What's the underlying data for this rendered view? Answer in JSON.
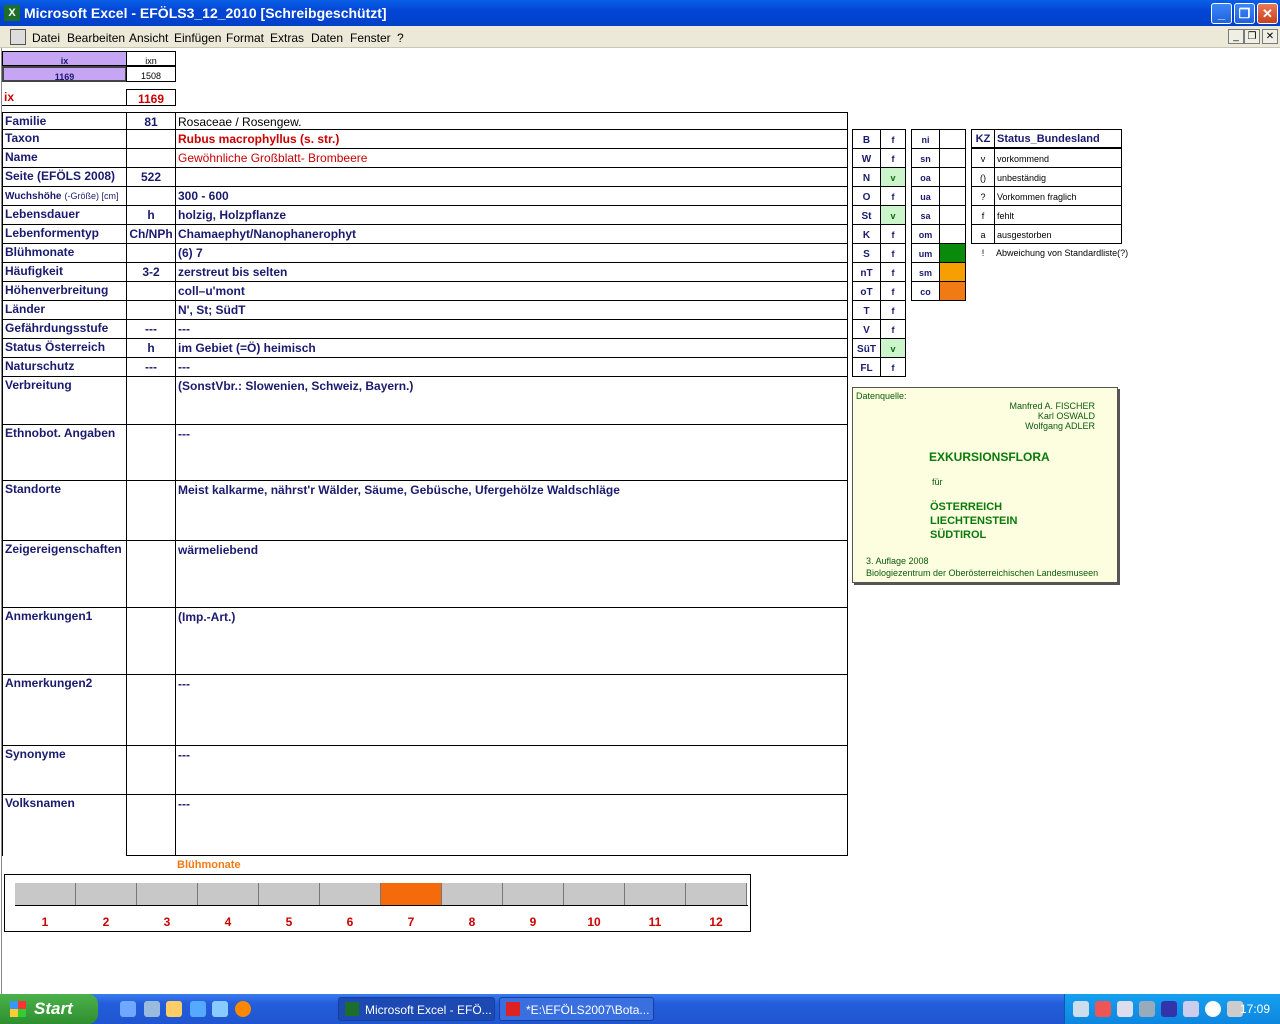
{
  "window": {
    "title": "Microsoft Excel - EFÖLS3_12_2010  [Schreibgeschützt]"
  },
  "menu": [
    "Datei",
    "Bearbeiten",
    "Ansicht",
    "Einfügen",
    "Format",
    "Extras",
    "Daten",
    "Fenster",
    "?"
  ],
  "top": {
    "ix_label": "ix",
    "ixn_label": "ixn",
    "ix_value": "1169",
    "ixn_value": "1508",
    "ix_main_label": "ix",
    "ix_main_value": "1169"
  },
  "rows": [
    {
      "label": "Familie",
      "num": "81",
      "value": "Rosaceae  /  Rosengew."
    },
    {
      "label": "Taxon",
      "num": "",
      "value": "Rubus macrophyllus (s. str.)"
    },
    {
      "label": "Name",
      "num": "",
      "value": "Gewöhnliche Großblatt- Brombeere"
    },
    {
      "label": "Seite (EFÖLS 2008)",
      "num": "522",
      "value": ""
    },
    {
      "label": "Wuchshöhe",
      "label_small": "(-Größe) [cm]",
      "num": "",
      "value": " 300 - 600"
    },
    {
      "label": "Lebensdauer",
      "num": "h",
      "value": "holzig, Holzpflanze"
    },
    {
      "label": "Lebenformentyp",
      "num": "Ch/NPh",
      "value": "Chamaephyt/Nanophanerophyt"
    },
    {
      "label": "Blühmonate",
      "num": "",
      "value": "(6) 7"
    },
    {
      "label": "Häufigkeit",
      "num": "3-2",
      "value": "zerstreut bis selten"
    },
    {
      "label": "Höhenverbreitung",
      "num": "",
      "value": "coll–u'mont"
    },
    {
      "label": "Länder",
      "num": "",
      "value": "N', St; SüdT"
    },
    {
      "label": "Gefährdungsstufe",
      "num": "---",
      "value": "  ---"
    },
    {
      "label": "Status Österreich",
      "num": "h",
      "value": "im Gebiet (=Ö) heimisch"
    },
    {
      "label": "Naturschutz",
      "num": "---",
      "value": " ---"
    },
    {
      "label": "Verbreitung",
      "num": "",
      "value": "(SonstVbr.: Slowenien, Schweiz, Bayern.)"
    },
    {
      "label": "Ethnobot. Angaben",
      "num": "",
      "value": "---"
    },
    {
      "label": "Standorte",
      "num": "",
      "value": "Meist kalkarme, nährst'r Wälder, Säume, Gebüsche, Ufergehölze Waldschläge"
    },
    {
      "label": "Zeigereigenschaften",
      "num": "",
      "value": "wärmeliebend"
    },
    {
      "label": "Anmerkungen1",
      "num": "",
      "value": "(Imp.-Art.)"
    },
    {
      "label": "Anmerkungen2",
      "num": "",
      "value": "---"
    },
    {
      "label": "Synonyme",
      "num": "",
      "value": "---"
    },
    {
      "label": "Volksnamen",
      "num": "",
      "value": "---"
    }
  ],
  "bundesland": [
    {
      "code": "B",
      "status": "f"
    },
    {
      "code": "W",
      "status": "f"
    },
    {
      "code": "N",
      "status": "v"
    },
    {
      "code": "O",
      "status": "f"
    },
    {
      "code": "St",
      "status": "v"
    },
    {
      "code": "K",
      "status": "f"
    },
    {
      "code": "S",
      "status": "f"
    },
    {
      "code": "nT",
      "status": "f"
    },
    {
      "code": "oT",
      "status": "f"
    },
    {
      "code": "T",
      "status": "f"
    },
    {
      "code": "V",
      "status": "f"
    },
    {
      "code": "SüT",
      "status": "v"
    },
    {
      "code": "FL",
      "status": "f"
    }
  ],
  "hoehen": [
    {
      "code": "ni"
    },
    {
      "code": "sn"
    },
    {
      "code": "oa"
    },
    {
      "code": "ua"
    },
    {
      "code": "sa"
    },
    {
      "code": "om"
    },
    {
      "code": "um",
      "color": "#0a8a0a"
    },
    {
      "code": "sm",
      "color": "#f5a000"
    },
    {
      "code": "co",
      "color": "#f07a14"
    }
  ],
  "legend": {
    "kz_header": "KZ",
    "status_header": "Status_Bundesland",
    "items": [
      {
        "kz": "v",
        "text": "vorkommend"
      },
      {
        "kz": "()",
        "text": "unbeständig"
      },
      {
        "kz": "?",
        "text": "Vorkommen fraglich"
      },
      {
        "kz": "f",
        "text": "fehlt"
      },
      {
        "kz": "a",
        "text": "ausgestorben"
      },
      {
        "kz": "!",
        "text": "Abweichung von Standardliste(?)"
      }
    ]
  },
  "source": {
    "label": "Datenquelle:",
    "authors": [
      "Manfred A. FISCHER",
      "Karl OSWALD",
      "Wolfgang ADLER"
    ],
    "title": "EXKURSIONSFLORA",
    "fuer": "für",
    "countries": [
      "ÖSTERREICH",
      "LIECHTENSTEIN",
      "SÜDTIROL"
    ],
    "edition": "3. Auflage 2008",
    "publisher": "Biologiezentrum der Oberösterreichischen Landesmuseen"
  },
  "months": {
    "title": "Blühmonate",
    "labels": [
      "1",
      "2",
      "3",
      "4",
      "5",
      "6",
      "7",
      "8",
      "9",
      "10",
      "11",
      "12"
    ],
    "highlight": [
      7
    ],
    "highlight_color": "#f56a0a"
  },
  "taskbar": {
    "start": "Start",
    "buttons": [
      "Microsoft Excel - EFÖ...",
      "*E:\\EFÖLS2007\\Bota..."
    ],
    "clock": "17:09"
  }
}
